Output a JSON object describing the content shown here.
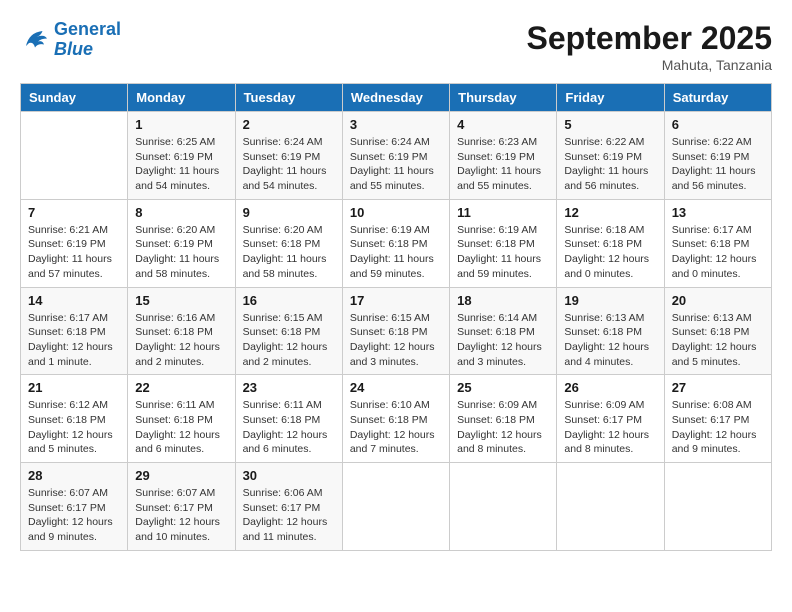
{
  "header": {
    "logo_line1": "General",
    "logo_line2": "Blue",
    "month": "September 2025",
    "location": "Mahuta, Tanzania"
  },
  "days_of_week": [
    "Sunday",
    "Monday",
    "Tuesday",
    "Wednesday",
    "Thursday",
    "Friday",
    "Saturday"
  ],
  "weeks": [
    [
      {
        "day": "",
        "info": ""
      },
      {
        "day": "1",
        "info": "Sunrise: 6:25 AM\nSunset: 6:19 PM\nDaylight: 11 hours\nand 54 minutes."
      },
      {
        "day": "2",
        "info": "Sunrise: 6:24 AM\nSunset: 6:19 PM\nDaylight: 11 hours\nand 54 minutes."
      },
      {
        "day": "3",
        "info": "Sunrise: 6:24 AM\nSunset: 6:19 PM\nDaylight: 11 hours\nand 55 minutes."
      },
      {
        "day": "4",
        "info": "Sunrise: 6:23 AM\nSunset: 6:19 PM\nDaylight: 11 hours\nand 55 minutes."
      },
      {
        "day": "5",
        "info": "Sunrise: 6:22 AM\nSunset: 6:19 PM\nDaylight: 11 hours\nand 56 minutes."
      },
      {
        "day": "6",
        "info": "Sunrise: 6:22 AM\nSunset: 6:19 PM\nDaylight: 11 hours\nand 56 minutes."
      }
    ],
    [
      {
        "day": "7",
        "info": "Sunrise: 6:21 AM\nSunset: 6:19 PM\nDaylight: 11 hours\nand 57 minutes."
      },
      {
        "day": "8",
        "info": "Sunrise: 6:20 AM\nSunset: 6:19 PM\nDaylight: 11 hours\nand 58 minutes."
      },
      {
        "day": "9",
        "info": "Sunrise: 6:20 AM\nSunset: 6:18 PM\nDaylight: 11 hours\nand 58 minutes."
      },
      {
        "day": "10",
        "info": "Sunrise: 6:19 AM\nSunset: 6:18 PM\nDaylight: 11 hours\nand 59 minutes."
      },
      {
        "day": "11",
        "info": "Sunrise: 6:19 AM\nSunset: 6:18 PM\nDaylight: 11 hours\nand 59 minutes."
      },
      {
        "day": "12",
        "info": "Sunrise: 6:18 AM\nSunset: 6:18 PM\nDaylight: 12 hours\nand 0 minutes."
      },
      {
        "day": "13",
        "info": "Sunrise: 6:17 AM\nSunset: 6:18 PM\nDaylight: 12 hours\nand 0 minutes."
      }
    ],
    [
      {
        "day": "14",
        "info": "Sunrise: 6:17 AM\nSunset: 6:18 PM\nDaylight: 12 hours\nand 1 minute."
      },
      {
        "day": "15",
        "info": "Sunrise: 6:16 AM\nSunset: 6:18 PM\nDaylight: 12 hours\nand 2 minutes."
      },
      {
        "day": "16",
        "info": "Sunrise: 6:15 AM\nSunset: 6:18 PM\nDaylight: 12 hours\nand 2 minutes."
      },
      {
        "day": "17",
        "info": "Sunrise: 6:15 AM\nSunset: 6:18 PM\nDaylight: 12 hours\nand 3 minutes."
      },
      {
        "day": "18",
        "info": "Sunrise: 6:14 AM\nSunset: 6:18 PM\nDaylight: 12 hours\nand 3 minutes."
      },
      {
        "day": "19",
        "info": "Sunrise: 6:13 AM\nSunset: 6:18 PM\nDaylight: 12 hours\nand 4 minutes."
      },
      {
        "day": "20",
        "info": "Sunrise: 6:13 AM\nSunset: 6:18 PM\nDaylight: 12 hours\nand 5 minutes."
      }
    ],
    [
      {
        "day": "21",
        "info": "Sunrise: 6:12 AM\nSunset: 6:18 PM\nDaylight: 12 hours\nand 5 minutes."
      },
      {
        "day": "22",
        "info": "Sunrise: 6:11 AM\nSunset: 6:18 PM\nDaylight: 12 hours\nand 6 minutes."
      },
      {
        "day": "23",
        "info": "Sunrise: 6:11 AM\nSunset: 6:18 PM\nDaylight: 12 hours\nand 6 minutes."
      },
      {
        "day": "24",
        "info": "Sunrise: 6:10 AM\nSunset: 6:18 PM\nDaylight: 12 hours\nand 7 minutes."
      },
      {
        "day": "25",
        "info": "Sunrise: 6:09 AM\nSunset: 6:18 PM\nDaylight: 12 hours\nand 8 minutes."
      },
      {
        "day": "26",
        "info": "Sunrise: 6:09 AM\nSunset: 6:17 PM\nDaylight: 12 hours\nand 8 minutes."
      },
      {
        "day": "27",
        "info": "Sunrise: 6:08 AM\nSunset: 6:17 PM\nDaylight: 12 hours\nand 9 minutes."
      }
    ],
    [
      {
        "day": "28",
        "info": "Sunrise: 6:07 AM\nSunset: 6:17 PM\nDaylight: 12 hours\nand 9 minutes."
      },
      {
        "day": "29",
        "info": "Sunrise: 6:07 AM\nSunset: 6:17 PM\nDaylight: 12 hours\nand 10 minutes."
      },
      {
        "day": "30",
        "info": "Sunrise: 6:06 AM\nSunset: 6:17 PM\nDaylight: 12 hours\nand 11 minutes."
      },
      {
        "day": "",
        "info": ""
      },
      {
        "day": "",
        "info": ""
      },
      {
        "day": "",
        "info": ""
      },
      {
        "day": "",
        "info": ""
      }
    ]
  ]
}
